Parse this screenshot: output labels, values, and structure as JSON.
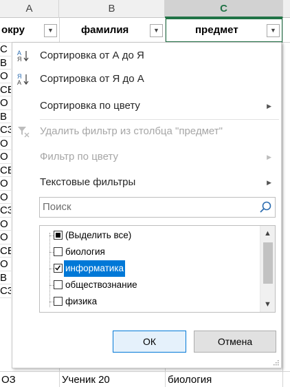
{
  "sheet": {
    "columns": [
      {
        "letter": "A"
      },
      {
        "letter": "B"
      },
      {
        "letter": "C"
      }
    ],
    "headers": {
      "a": "окру",
      "b": "фамилия",
      "c": "предмет"
    },
    "left_fragments": [
      "С",
      "В",
      "О",
      "СВ",
      "О",
      "В",
      "СЗ",
      "О",
      "О",
      "СВ",
      "О",
      "О",
      "СЗ",
      "О",
      "О",
      "СВ",
      "О",
      "В",
      "СЗ"
    ],
    "bottom_row": {
      "a": "ОЗ",
      "b": "Ученик 20",
      "c": "биология"
    }
  },
  "menu": {
    "sort_asc": "Сортировка от А до Я",
    "sort_desc": "Сортировка от Я до А",
    "sort_color": "Сортировка по цвету",
    "clear_filter": "Удалить фильтр из столбца \"предмет\"",
    "filter_color": "Фильтр по цвету",
    "text_filters": "Текстовые фильтры",
    "search_placeholder": "Поиск",
    "items": [
      {
        "label": "(Выделить все)",
        "state": "partial"
      },
      {
        "label": "биология",
        "state": "unchecked"
      },
      {
        "label": "информатика",
        "state": "checked"
      },
      {
        "label": "обществознание",
        "state": "unchecked"
      },
      {
        "label": "физика",
        "state": "unchecked"
      }
    ],
    "ok_label": "ОК",
    "cancel_label": "Отмена"
  },
  "colors": {
    "accent_green": "#217346",
    "selection_blue": "#0078d7",
    "ok_bg": "#e5f1fb",
    "disabled_text": "#a6a6a6"
  }
}
